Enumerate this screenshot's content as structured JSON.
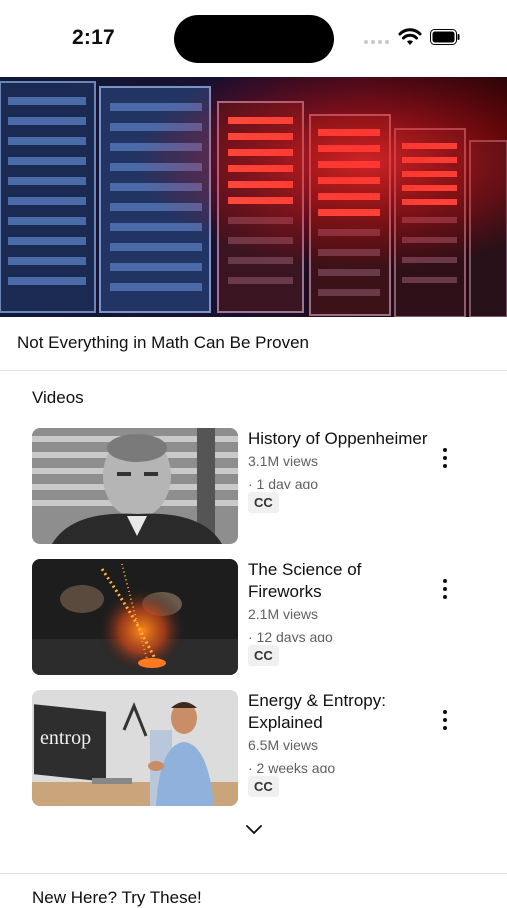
{
  "status_bar": {
    "time": "2:17"
  },
  "hero": {
    "title": "Not Everything in Math Can Be Proven"
  },
  "section": {
    "title": "Videos"
  },
  "videos": [
    {
      "title": "History of Oppenheimer",
      "views": "3.1M views",
      "age": "· 1 day ago",
      "cc": "CC"
    },
    {
      "title": "The Science of Fireworks",
      "views": "2.1M views",
      "age": "· 12 days ago",
      "cc": "CC"
    },
    {
      "title": "Energy & Entropy: Explained",
      "views": "6.5M views",
      "age": "· 2 weeks ago",
      "cc": "CC"
    }
  ],
  "next_section": {
    "title": "New Here? Try These!"
  },
  "icons": {
    "wifi": "wifi-icon",
    "battery": "battery-icon",
    "more": "more-vertical-icon",
    "expand": "chevron-down-icon"
  }
}
